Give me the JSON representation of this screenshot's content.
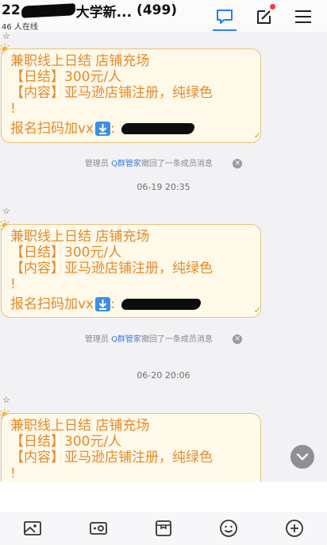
{
  "header": {
    "title_prefix": "22",
    "title_mid": "大学新...",
    "member_count": "(499)",
    "online_status": "46 人在线",
    "icons": [
      "chat-bubble-icon",
      "compose-icon",
      "menu-icon"
    ],
    "accent_color": "#2a7cf6",
    "notify_dot_color": "#ff3b30"
  },
  "messages": [
    {
      "star": "☆",
      "line1": "兼职线上日结 店铺充场",
      "line2": "【日结】300元/人",
      "line3": "【内容】亚马逊店铺注册，纯绿色",
      "line4": "!",
      "line5": "报名扫码加vx",
      "sep": ":"
    },
    {
      "star": "☆",
      "line1": "兼职线上日结 店铺充场",
      "line2": "【日结】300元/人",
      "line3": "【内容】亚马逊店铺注册，纯绿色",
      "line4": "!",
      "line5": "报名扫码加vx",
      "sep": ":"
    },
    {
      "star": "☆",
      "line1": "兼职线上日结 店铺充场",
      "line2": "【日结】300元/人",
      "line3": "【内容】亚马逊店铺注册，纯绿色",
      "line4": "!"
    }
  ],
  "system_notices": [
    {
      "role": "管理员",
      "bot": "Q群管家",
      "text": "撤回了一条成员消息"
    },
    {
      "role": "管理员",
      "bot": "Q群管家",
      "text": "撤回了一条成员消息"
    }
  ],
  "timestamps": [
    "06-19 20:35",
    "06-20 20:06"
  ],
  "bubble_colors": {
    "text": "#e68a2a",
    "border": "#e9c27c",
    "background": "#fff9ea"
  },
  "input": {
    "value": "",
    "placeholder": ""
  },
  "toolbar": [
    "image-icon",
    "keyboard-icon",
    "album-icon",
    "emoji-icon",
    "add-icon"
  ]
}
